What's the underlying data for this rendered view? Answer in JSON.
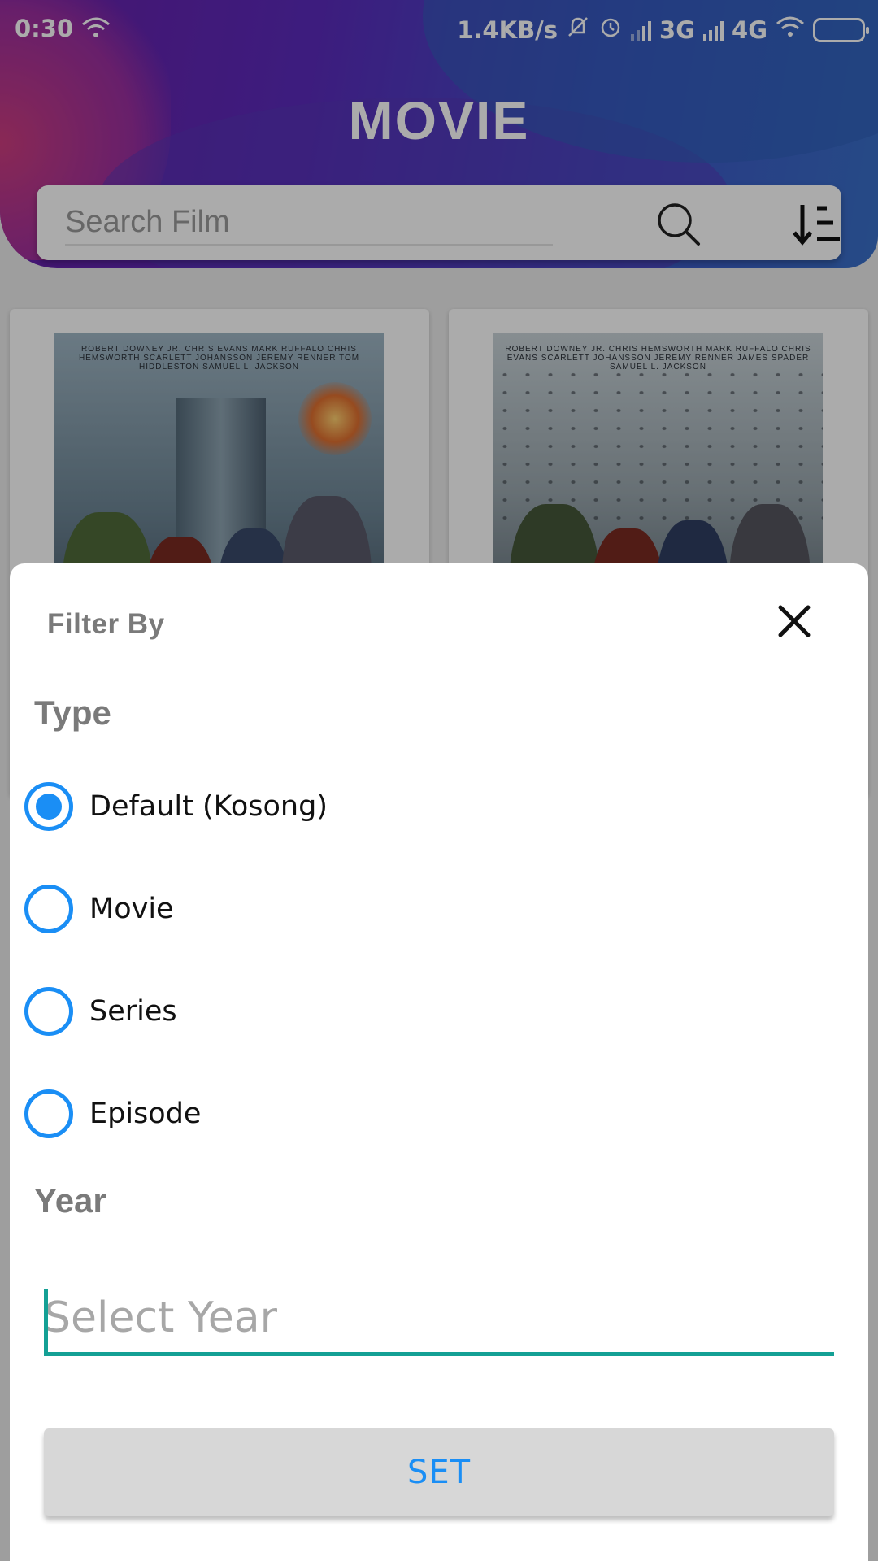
{
  "status_bar": {
    "time": "0:30",
    "speed": "1.4KB/s",
    "net1": "3G",
    "net2": "4G",
    "icons": [
      "wifi-icon",
      "mute-icon",
      "alarm-icon",
      "signal-icon",
      "battery-icon"
    ]
  },
  "header": {
    "title": "MOVIE",
    "search_placeholder": "Search Film",
    "gradient": [
      "#6a1fa8",
      "#3a70c8"
    ]
  },
  "movies": [
    {
      "poster_credits": "ROBERT DOWNEY JR. CHRIS EVANS MARK RUFFALO CHRIS HEMSWORTH SCARLETT JOHANSSON JEREMY RENNER TOM HIDDLESTON SAMUEL L. JACKSON"
    },
    {
      "poster_credits": "ROBERT DOWNEY JR. CHRIS HEMSWORTH MARK RUFFALO CHRIS EVANS SCARLETT JOHANSSON JEREMY RENNER JAMES SPADER SAMUEL L. JACKSON"
    }
  ],
  "filter_sheet": {
    "title": "Filter By",
    "type_label": "Type",
    "options": [
      {
        "label": "Default (Kosong)",
        "checked": true
      },
      {
        "label": "Movie",
        "checked": false
      },
      {
        "label": "Series",
        "checked": false
      },
      {
        "label": "Episode",
        "checked": false
      }
    ],
    "year_label": "Year",
    "year_placeholder": "Select Year",
    "year_value": "",
    "set_button": "SET"
  },
  "colors": {
    "accent": "#1a8ef5",
    "input_underline": "#14a095",
    "label_gray": "#7a7a7a",
    "button_bg": "#d7d7d7"
  }
}
